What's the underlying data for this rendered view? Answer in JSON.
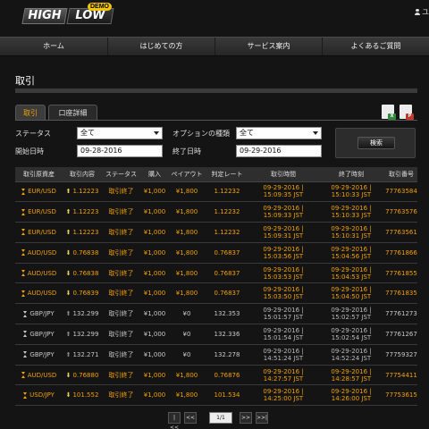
{
  "header": {
    "logo_high": "HIGH",
    "logo_low": "LOW",
    "logo_demo": "DEMO",
    "user_label": "ユ"
  },
  "nav": [
    "ホーム",
    "はじめての方",
    "サービス案内",
    "よくあるご質問"
  ],
  "page": {
    "title": "取引"
  },
  "tabs": [
    "取引",
    "口座詳細"
  ],
  "filters": {
    "status_label": "ステータス",
    "status_value": "全て",
    "option_type_label": "オプションの種類",
    "option_type_value": "全て",
    "start_label": "開始日時",
    "start_value": "09-28-2016",
    "end_label": "終了日時",
    "end_value": "09-29-2016",
    "search_label": "検索"
  },
  "table": {
    "headers": [
      "取引原資産",
      "取引内容",
      "ステータス",
      "購入",
      "ペイアウト",
      "判定レート",
      "取引時間",
      "終了時刻",
      "取引番号"
    ],
    "rows": [
      {
        "asset": "EUR/USD",
        "dir": "up",
        "rate": "1.12223",
        "status": "取引終了",
        "buy": "¥1,000",
        "payout": "¥1,800",
        "judge": "1.12232",
        "t1": "09-29-2016 |",
        "t2": "15:09:35 JST",
        "e1": "09-29-2016 |",
        "e2": "15:10:33 JST",
        "id": "77763584",
        "win": true
      },
      {
        "asset": "EUR/USD",
        "dir": "up",
        "rate": "1.12223",
        "status": "取引終了",
        "buy": "¥1,000",
        "payout": "¥1,800",
        "judge": "1.12232",
        "t1": "09-29-2016 |",
        "t2": "15:09:33 JST",
        "e1": "09-29-2016 |",
        "e2": "15:10:33 JST",
        "id": "77763576",
        "win": true
      },
      {
        "asset": "EUR/USD",
        "dir": "up",
        "rate": "1.12223",
        "status": "取引終了",
        "buy": "¥1,000",
        "payout": "¥1,800",
        "judge": "1.12232",
        "t1": "09-29-2016 |",
        "t2": "15:09:31 JST",
        "e1": "09-29-2016 |",
        "e2": "15:10:31 JST",
        "id": "77763561",
        "win": true
      },
      {
        "asset": "AUD/USD",
        "dir": "down",
        "rate": "0.76838",
        "status": "取引終了",
        "buy": "¥1,000",
        "payout": "¥1,800",
        "judge": "0.76837",
        "t1": "09-29-2016 |",
        "t2": "15:03:56 JST",
        "e1": "09-29-2016 |",
        "e2": "15:04:56 JST",
        "id": "77761866",
        "win": true
      },
      {
        "asset": "AUD/USD",
        "dir": "down",
        "rate": "0.76838",
        "status": "取引終了",
        "buy": "¥1,000",
        "payout": "¥1,800",
        "judge": "0.76837",
        "t1": "09-29-2016 |",
        "t2": "15:03:53 JST",
        "e1": "09-29-2016 |",
        "e2": "15:04:53 JST",
        "id": "77761855",
        "win": true
      },
      {
        "asset": "AUD/USD",
        "dir": "down",
        "rate": "0.76839",
        "status": "取引終了",
        "buy": "¥1,000",
        "payout": "¥1,800",
        "judge": "0.76837",
        "t1": "09-29-2016 |",
        "t2": "15:03:50 JST",
        "e1": "09-29-2016 |",
        "e2": "15:04:50 JST",
        "id": "77761835",
        "win": true
      },
      {
        "asset": "GBP/JPY",
        "dir": "up",
        "rate": "132.299",
        "status": "取引終了",
        "buy": "¥1,000",
        "payout": "¥0",
        "judge": "132.353",
        "t1": "09-29-2016 |",
        "t2": "15:01:57 JST",
        "e1": "09-29-2016 |",
        "e2": "15:02:57 JST",
        "id": "77761273",
        "win": false
      },
      {
        "asset": "GBP/JPY",
        "dir": "up",
        "rate": "132.299",
        "status": "取引終了",
        "buy": "¥1,000",
        "payout": "¥0",
        "judge": "132.336",
        "t1": "09-29-2016 |",
        "t2": "15:01:54 JST",
        "e1": "09-29-2016 |",
        "e2": "15:02:54 JST",
        "id": "77761267",
        "win": false
      },
      {
        "asset": "GBP/JPY",
        "dir": "up",
        "rate": "132.271",
        "status": "取引終了",
        "buy": "¥1,000",
        "payout": "¥0",
        "judge": "132.278",
        "t1": "09-29-2016 |",
        "t2": "14:51:24 JST",
        "e1": "09-29-2016 |",
        "e2": "14:52:24 JST",
        "id": "77759327",
        "win": false
      },
      {
        "asset": "AUD/USD",
        "dir": "down",
        "rate": "0.76880",
        "status": "取引終了",
        "buy": "¥1,000",
        "payout": "¥1,800",
        "judge": "0.76876",
        "t1": "09-29-2016 |",
        "t2": "14:27:57 JST",
        "e1": "09-29-2016 |",
        "e2": "14:28:57 JST",
        "id": "77754411",
        "win": true
      },
      {
        "asset": "USD/JPY",
        "dir": "down",
        "rate": "101.552",
        "status": "取引終了",
        "buy": "¥1,000",
        "payout": "¥1,800",
        "judge": "101.534",
        "t1": "09-29-2016 |",
        "t2": "14:25:00 JST",
        "e1": "09-29-2016 |",
        "e2": "14:26:00 JST",
        "id": "77753615",
        "win": true
      }
    ]
  },
  "pager": {
    "first": "|<<",
    "prev": "<<",
    "page": "1/1",
    "next": ">>",
    "last": ">>|"
  },
  "colors": {
    "accent": "#f2a200",
    "background": "#141414",
    "excel": "#2e8b3a",
    "pdf": "#c0392b"
  },
  "icons": [
    "excel-export-icon",
    "pdf-export-icon",
    "user-icon",
    "hourglass-icon",
    "up-arrow-icon",
    "down-arrow-icon"
  ]
}
